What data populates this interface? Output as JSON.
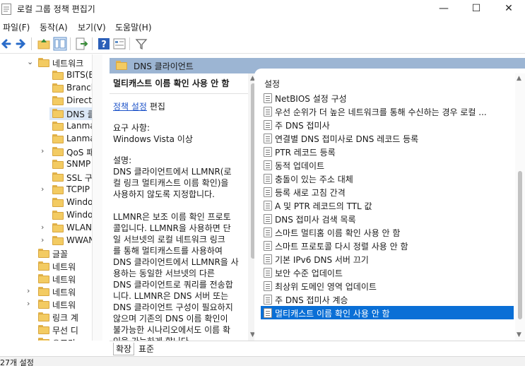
{
  "window": {
    "title": "로컬 그룹 정책 편집기"
  },
  "menu": [
    "파일(F)",
    "동작(A)",
    "보기(V)",
    "도움말(H)"
  ],
  "tree": [
    {
      "label": "네트워크",
      "chevron": "⌄",
      "indent": 1
    },
    {
      "label": "BITS(B…",
      "chevron": "",
      "indent": 2
    },
    {
      "label": "Branch",
      "chevron": "",
      "indent": 2
    },
    {
      "label": "Directa",
      "chevron": "",
      "indent": 2
    },
    {
      "label": "DNS 클",
      "chevron": "",
      "indent": 2,
      "selected": true
    },
    {
      "label": "Lanma",
      "chevron": "",
      "indent": 2
    },
    {
      "label": "Lanma",
      "chevron": "",
      "indent": 2
    },
    {
      "label": "QoS 패",
      "chevron": "›",
      "indent": 2
    },
    {
      "label": "SNMP",
      "chevron": "",
      "indent": 2
    },
    {
      "label": "SSL 구",
      "chevron": "",
      "indent": 2
    },
    {
      "label": "TCPIP",
      "chevron": "›",
      "indent": 2
    },
    {
      "label": "Windo",
      "chevron": "",
      "indent": 2
    },
    {
      "label": "Windo",
      "chevron": "",
      "indent": 2
    },
    {
      "label": "WLAN",
      "chevron": "›",
      "indent": 2
    },
    {
      "label": "WWAN",
      "chevron": "›",
      "indent": 2
    },
    {
      "label": "글꼴",
      "chevron": "",
      "indent": 1
    },
    {
      "label": "네트워",
      "chevron": "",
      "indent": 1
    },
    {
      "label": "네트워",
      "chevron": "",
      "indent": 1
    },
    {
      "label": "네트워",
      "chevron": "›",
      "indent": 1
    },
    {
      "label": "네트워",
      "chevron": "›",
      "indent": 1
    },
    {
      "label": "링크 계",
      "chevron": "",
      "indent": 1
    },
    {
      "label": "무선 디",
      "chevron": "",
      "indent": 1
    },
    {
      "label": "오프라",
      "chevron": "",
      "indent": 1
    }
  ],
  "detail": {
    "folder_title": "DNS 클라이언트",
    "policy_title": "멀티캐스트 이름 확인 사용 안 함",
    "edit_link": "정책 설정",
    "edit_suffix": "편집",
    "requirements_label": "요구 사항:",
    "requirements_value": "Windows Vista 이상",
    "description_label": "설명:",
    "description_lines": [
      "DNS 클라이언트에서 LLMNR(로",
      "컬 링크 멀티캐스트 이름 확인)을",
      "사용하지 않도록 지정합니다.",
      "",
      "LLMNR은 보조 이름 확인 프로토",
      "콜입니다. LLMNR을 사용하면 단",
      "일 서브넷의 로컬 네트워크 링크",
      "를 통해 멀티캐스트를 사용하여",
      "DNS 클라이언트에서 LLMNR을 사",
      "용하는 동일한 서브넷의 다른",
      "DNS 클라이언트로 쿼리를 전송합",
      "니다. LLMNR은 DNS 서버 또는",
      "DNS 클라이언트 구성이 필요하지",
      "않으며 기존의 DNS 이름 확인이",
      "불가능한 시나리오에서도 이름 확",
      "인을 가능하게 합니다."
    ]
  },
  "settings": {
    "header": "설정",
    "items": [
      "NetBIOS 설정 구성",
      "우선 순위가 더 높은 네트워크를 통해 수신하는 경우 로컬 ...",
      "주 DNS 접미사",
      "연결별 DNS 접미사로 DNS 레코드 등록",
      "PTR 레코드 등록",
      "동적 업데이트",
      "충돌이 있는 주소 대체",
      "등록 새로 고침 간격",
      "A 및 PTR 레코드의 TTL 값",
      "DNS 접미사 검색 목록",
      "스마트 멀티홈 이름 확인 사용 안 함",
      "스마트 프로토콜 다시 정렬 사용 안 함",
      "기본 IPv6 DNS 서버 끄기",
      "보안 수준 업데이트",
      "최상위 도메인 영역 업데이트",
      "주 DNS 접미사 계승",
      "멀티캐스트 이름 확인 사용 안 함"
    ],
    "selected_index": 16
  },
  "tabs": [
    "확장",
    "표준"
  ],
  "status": {
    "text": "27개 설정"
  },
  "colors": {
    "selection": "#0a6fd6",
    "header_band": "#9cb5d3",
    "tree_selected": "#dbe8f7"
  }
}
